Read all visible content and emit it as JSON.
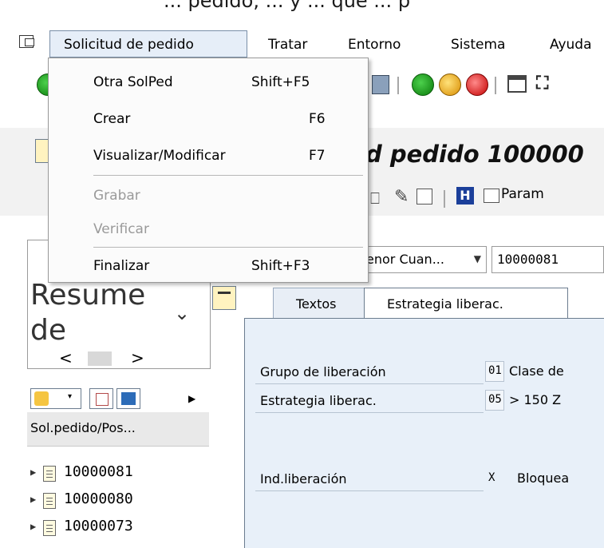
{
  "window": {
    "title_fragment": "... pedido, ... y ... que ... p",
    "transaction_title": "d pedido 100000"
  },
  "menubar": {
    "items": [
      {
        "label": "Solicitud de pedido",
        "mnemonic_index": 1
      },
      {
        "label": "Tratar"
      },
      {
        "label": "Entorno"
      },
      {
        "label": "Sistema"
      },
      {
        "label": "Ayuda"
      }
    ]
  },
  "menu": {
    "items": [
      {
        "label": "Otra SolPed",
        "shortcut": "Shift+F5",
        "enabled": true
      },
      {
        "label": "Crear",
        "shortcut": "F6",
        "enabled": true
      },
      {
        "label": "Visualizar/Modificar",
        "shortcut": "F7",
        "enabled": true
      },
      {
        "label": "Grabar",
        "shortcut": "",
        "enabled": false
      },
      {
        "label": "Verificar",
        "shortcut": "",
        "enabled": false
      },
      {
        "label": "Finalizar",
        "shortcut": "Shift+F3",
        "enabled": true
      }
    ]
  },
  "apptoolbar": {
    "params_label": "Param"
  },
  "nav": {
    "overview_title": "Resume de",
    "tree_header": "Sol.pedido/Pos...",
    "tree_items": [
      "10000081",
      "10000080",
      "10000073"
    ]
  },
  "header_fields": {
    "doc_type_value": "enor Cuan...",
    "doc_number": "10000081"
  },
  "tabs": [
    {
      "label": "Textos",
      "active": false
    },
    {
      "label": "Estrategia liberac.",
      "active": true
    }
  ],
  "release": {
    "rows": [
      {
        "label": "Grupo de liberación",
        "code": "01",
        "text": "Clase de"
      },
      {
        "label": "Estrategia liberac.",
        "code": "05",
        "text": "> 150 Z"
      },
      {
        "label": "Ind.liberación",
        "code": "X",
        "text": "Bloquea"
      }
    ]
  },
  "colors": {
    "menu_highlight": "#e6eef8",
    "content_bg": "#e8f0f9",
    "disabled_text": "#9a9a9a"
  }
}
